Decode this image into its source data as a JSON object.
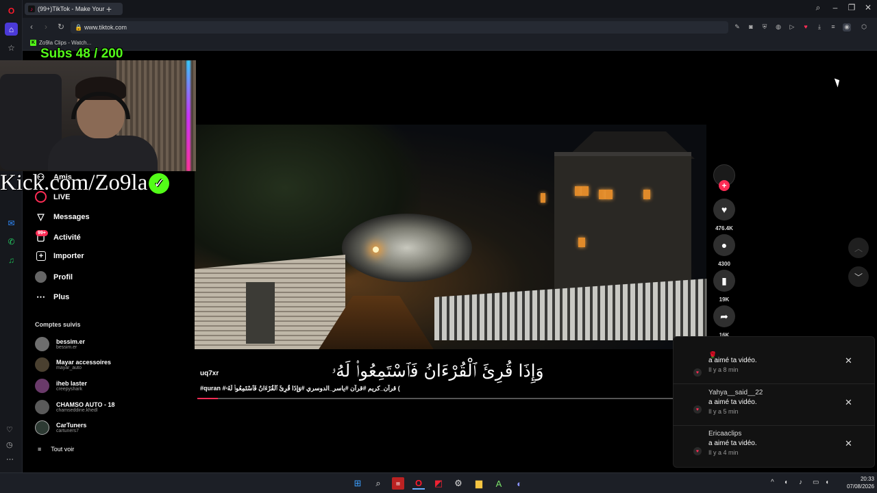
{
  "browser": {
    "tab_title": "(99+)TikTok - Make Your",
    "url": "www.tiktok.com",
    "bookmark": "Zo9la Clips - Watch..."
  },
  "stream_overlay": {
    "subs_label": "Subs 48 / 200",
    "kick_text": "Kick.com/Zo9la"
  },
  "sidebar": {
    "items": [
      {
        "label": "Amis",
        "icon": "users-icon"
      },
      {
        "label": "LIVE",
        "icon": "live-icon"
      },
      {
        "label": "Messages",
        "icon": "send-icon"
      },
      {
        "label": "Activité",
        "icon": "inbox-icon"
      },
      {
        "label": "Importer",
        "icon": "plus-square-icon"
      },
      {
        "label": "Profil",
        "icon": "profile-icon"
      },
      {
        "label": "Plus",
        "icon": "more-icon"
      }
    ],
    "activity_badge": "99+",
    "following_title": "Comptes suivis",
    "following": [
      {
        "name": "bessim.er",
        "handle": "bessim.er"
      },
      {
        "name": "Mayar accessoires",
        "handle": "mayar_auto"
      },
      {
        "name": "iheb laster",
        "handle": "creepyshark"
      },
      {
        "name": "CHAMSO AUTO - 18",
        "handle": "chamseddine.khedl"
      },
      {
        "name": "CarTuners",
        "handle": "cartuners7"
      }
    ],
    "see_all": "Tout voir"
  },
  "video": {
    "author": "uq7xr",
    "description": "#quran #قرآن_كريم #قرآن #ياسر_الدوسري #وَإِذَا قُرِئَ ٱلْقُرْءَانُ فَٱسْتَمِعُوا۟ لَهُۥ (",
    "subtitle": "وَإِذَا قُرِئَ ٱلْقُرْءَانُ فَٱسْتَمِعُوا۟ لَهُۥ",
    "progress": 0.04
  },
  "actions": {
    "likes": "476.4K",
    "comments": "4300",
    "saves": "19K",
    "shares": "16K"
  },
  "notifications": [
    {
      "who": "🌹",
      "what": "a aimé ta vidéo.",
      "when": "Il y a 8 min"
    },
    {
      "who": "Yahya__said__22",
      "what": "a aimé ta vidéo.",
      "when": "Il y a 5 min"
    },
    {
      "who": "Ericaaclips",
      "what": "a aimé ta vidéo.",
      "when": "Il y a 4 min"
    }
  ],
  "taskbar": {
    "time": "20:33",
    "date": "07/08/2026"
  },
  "colors": {
    "tiktok_red": "#fe2c55",
    "kick_green": "#53fc18"
  }
}
